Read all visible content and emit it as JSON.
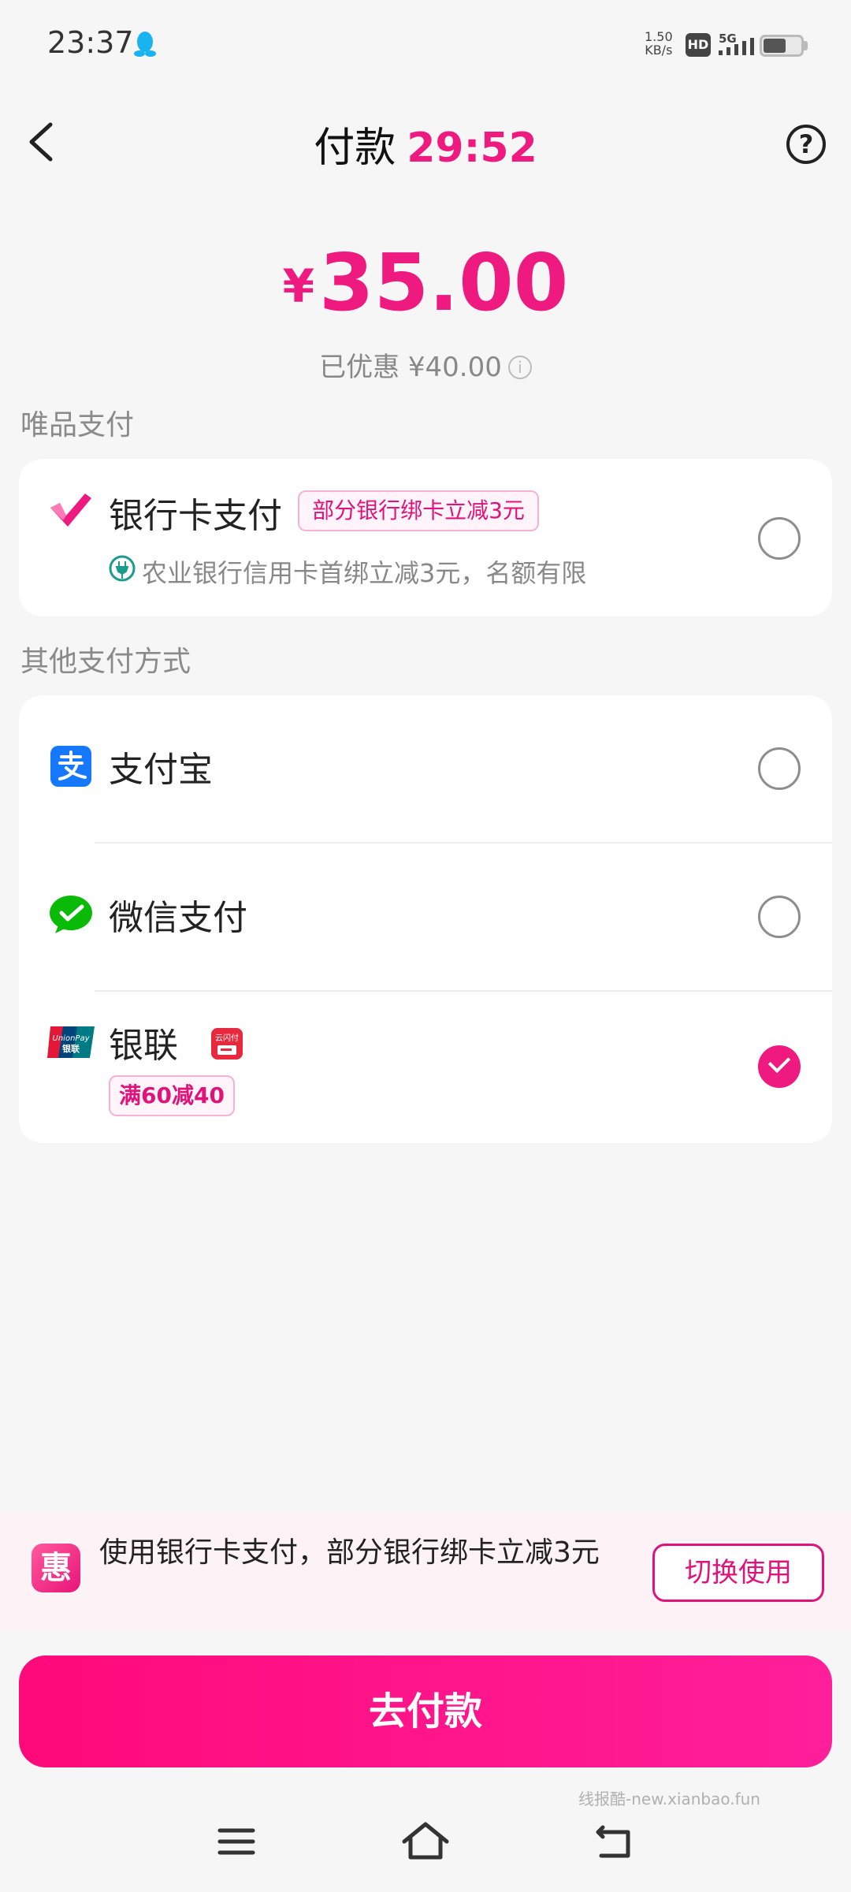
{
  "status_bar": {
    "time": "23:37",
    "net_speed_value": "1.50",
    "net_speed_unit": "KB/s",
    "hd_label": "HD",
    "network_label": "5G",
    "icons": [
      "qq-icon",
      "hd-icon",
      "signal-icon",
      "battery-icon"
    ]
  },
  "header": {
    "title": "付款",
    "countdown": "29:52",
    "help_label": "?"
  },
  "payment": {
    "currency": "¥",
    "amount": "35.00",
    "discount_text": "已优惠 ¥40.00",
    "info_label": "i"
  },
  "vip_section": {
    "label": "唯品支付",
    "method": {
      "name": "银行卡支付",
      "tag": "部分银行绑卡立减3元",
      "note": "农业银行信用卡首绑立减3元，名额有限",
      "selected": false
    }
  },
  "other_section": {
    "label": "其他支付方式",
    "methods": [
      {
        "name": "支付宝",
        "icon": "alipay-icon",
        "selected": false
      },
      {
        "name": "微信支付",
        "icon": "wechat-pay-icon",
        "selected": false
      },
      {
        "name": "银联",
        "icon": "unionpay-icon",
        "tag": "满60减40",
        "selected": true,
        "sub_icon": "cloud-quickpass-icon",
        "unionpay_logo_text": "UnionPay",
        "unionpay_cn_text": "银联",
        "quickpass_text": "云闪付"
      }
    ]
  },
  "promo_banner": {
    "icon_text": "惠",
    "text": "使用银行卡支付，部分银行绑卡立减3元",
    "button_label": "切换使用"
  },
  "pay_button": {
    "label": "去付款"
  },
  "watermark": "线报酷-new.xianbao.fun",
  "colors": {
    "accent": "#ee1a7f",
    "background": "#f6f6f6",
    "card": "#ffffff"
  }
}
